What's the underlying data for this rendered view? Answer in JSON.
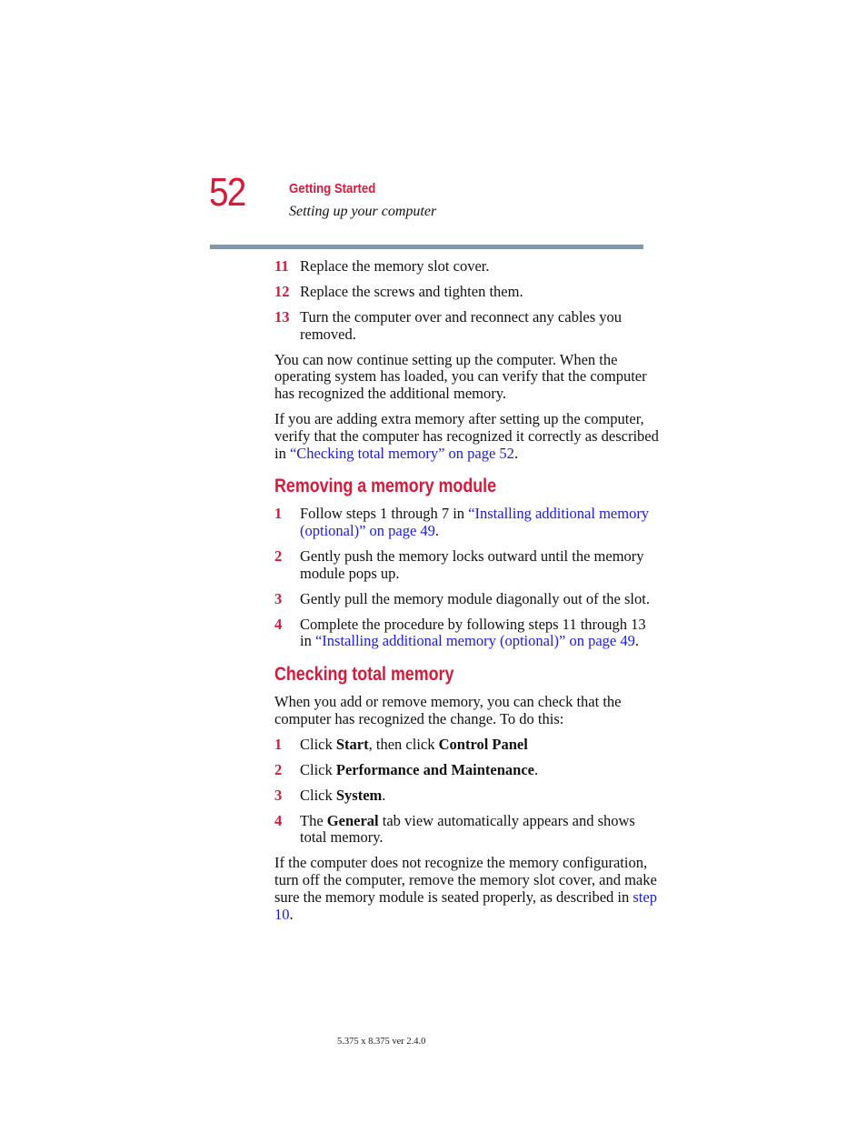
{
  "header": {
    "page_number": "52",
    "chapter_title": "Getting Started",
    "section_subtitle": "Setting up your computer",
    "accent_color": "#d7193a",
    "rule_color": "#7d98b1"
  },
  "intro_steps": [
    {
      "num": "11",
      "text": "Replace the memory slot cover."
    },
    {
      "num": "12",
      "text": "Replace the screws and tighten them."
    },
    {
      "num": "13",
      "text": "Turn the computer over and reconnect any cables you removed."
    }
  ],
  "para1": "You can now continue setting up the computer. When the operating system has loaded, you can verify that the computer has recognized the additional memory.",
  "para2": {
    "before": "If you are adding extra memory after setting up the computer, verify that the computer has recognized it correctly as described in ",
    "link": "“Checking total memory” on page 52",
    "after": "."
  },
  "removing": {
    "heading": "Removing a memory module",
    "steps": [
      {
        "num": "1",
        "before": "Follow steps 1 through 7 in ",
        "link": "“Installing additional memory (optional)” on page 49",
        "after": "."
      },
      {
        "num": "2",
        "text": "Gently push the memory locks outward until the memory module pops up."
      },
      {
        "num": "3",
        "text": "Gently pull the memory module diagonally out of the slot."
      },
      {
        "num": "4",
        "before": "Complete the procedure by following steps 11 through 13 in ",
        "link": "“Installing additional memory (optional)” on page 49",
        "after": "."
      }
    ]
  },
  "checking": {
    "heading": "Checking total memory",
    "intro": "When you add or remove memory, you can check that the computer has recognized the change. To do this:",
    "steps": [
      {
        "num": "1",
        "t1": "Click ",
        "b1": "Start",
        "t2": ", then click ",
        "b2": "Control Panel",
        "t3": ""
      },
      {
        "num": "2",
        "t1": "Click ",
        "b1": "Performance and Maintenance",
        "t2": "."
      },
      {
        "num": "3",
        "t1": "Click ",
        "b1": "System",
        "t2": "."
      },
      {
        "num": "4",
        "t1": "The ",
        "b1": "General",
        "t2": " tab view automatically appears and shows total memory."
      }
    ],
    "closing": {
      "before": "If the computer does not recognize the memory configuration, turn off the computer, remove the memory slot cover, and make sure the memory module is seated properly, as described in ",
      "link": "step 10",
      "after": "."
    }
  },
  "footer": "5.375 x 8.375 ver 2.4.0"
}
